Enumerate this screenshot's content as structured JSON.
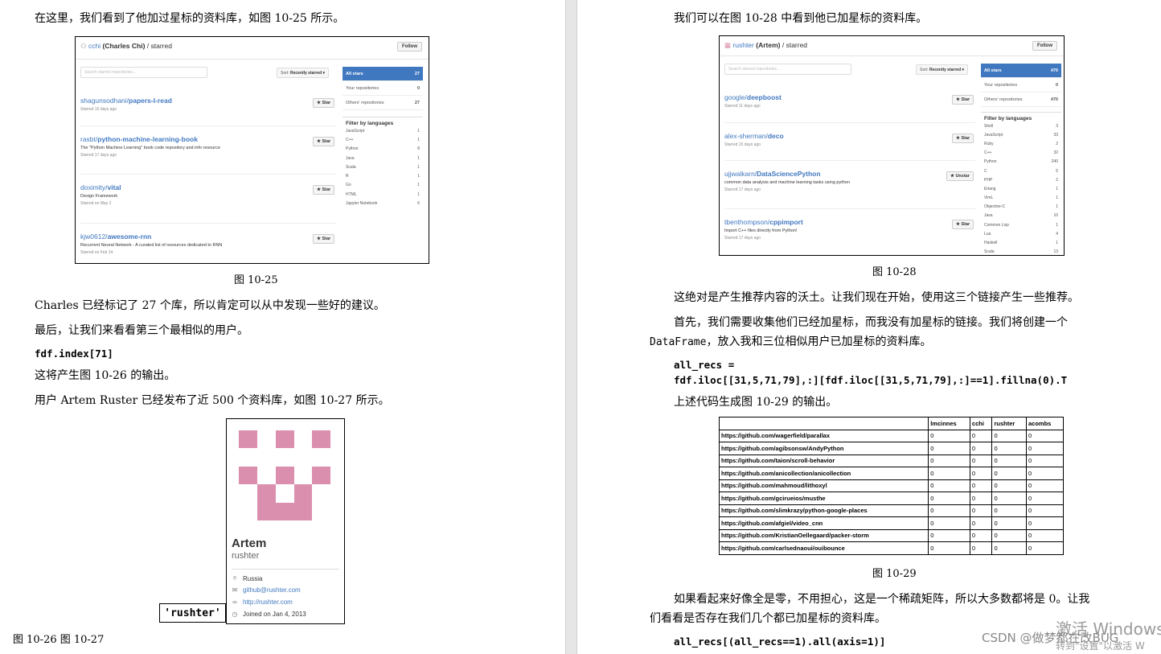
{
  "left": {
    "intro": "在这里，我们看到了他加过星标的资料库，如图 10-25 所示。",
    "fig25": {
      "user": "cchi",
      "fullname": "(Charles Chi)",
      "section": "/ starred",
      "follow": "Follow",
      "search_placeholder": "Search starred repositories...",
      "sort_prefix": "Sort:",
      "sort_value": "Recently starred ▾",
      "repos": [
        {
          "owner": "shagunsodhani/",
          "name": "papers-I-read",
          "desc": "",
          "date": "Starred 16 days ago",
          "btn": "★ Star"
        },
        {
          "owner": "rasbt/",
          "name": "python-machine-learning-book",
          "desc": "The \"Python Machine Learning\" book code repository and info resource",
          "date": "Starred 17 days ago",
          "btn": "★ Star"
        },
        {
          "owner": "doximity/",
          "name": "vital",
          "desc": "Design Framework",
          "date": "Starred on May 2",
          "btn": "★ Star"
        },
        {
          "owner": "kjw0612/",
          "name": "awesome-rnn",
          "desc": "Recurrent Neural Network - A curated list of resources dedicated to RNN",
          "date": "Starred on Feb 14",
          "btn": "★ Star"
        }
      ],
      "tabs": [
        {
          "label": "All stars",
          "count": "27"
        },
        {
          "label": "Your repositories",
          "count": "0"
        },
        {
          "label": "Others' repositories",
          "count": "27"
        }
      ],
      "filter_title": "Filter by languages",
      "languages": [
        {
          "name": "JavaScript",
          "count": "1"
        },
        {
          "name": "C++",
          "count": "1"
        },
        {
          "name": "Python",
          "count": "8"
        },
        {
          "name": "Java",
          "count": "1"
        },
        {
          "name": "Scala",
          "count": "1"
        },
        {
          "name": "R",
          "count": "1"
        },
        {
          "name": "Go",
          "count": "1"
        },
        {
          "name": "HTML",
          "count": "1"
        },
        {
          "name": "Jupyter Notebook",
          "count": "6"
        }
      ]
    },
    "caption25": "图 10-25",
    "p1": "Charles 已经标记了 27 个库，所以肯定可以从中发现一些好的建议。",
    "p2": "最后，让我们来看看第三个最相似的用户。",
    "code1": "fdf.index[71]",
    "p3": "这将产生图 10-26 的输出。",
    "p4": "用户 Artem Ruster 已经发布了近 500 个资料库，如图 10-27 所示。",
    "profile": {
      "name": "Artem",
      "login": "rushter",
      "location": "Russia",
      "email": "github@rushter.com",
      "url": "http://rushter.com",
      "joined": "Joined on Jan 4, 2013"
    },
    "rushter_label": "'rushter'",
    "caption2627": "图 10-26 图 10-27"
  },
  "right": {
    "intro": "我们可以在图 10-28 中看到他已加星标的资料库。",
    "fig28": {
      "user": "rushter",
      "fullname": "(Artem)",
      "section": "/ starred",
      "follow": "Follow",
      "search_placeholder": "Search starred repositories...",
      "sort_prefix": "Sort:",
      "sort_value": "Recently starred ▾",
      "repos": [
        {
          "owner": "google/",
          "name": "deepboost",
          "desc": "",
          "date": "Starred 11 days ago",
          "btn": "★ Star"
        },
        {
          "owner": "alex-sherman/",
          "name": "deco",
          "desc": "",
          "date": "Starred 15 days ago",
          "btn": "★ Star"
        },
        {
          "owner": "ujjwalkarn/",
          "name": "DataSciencePython",
          "desc": "common data analysis and machine learning tasks using python",
          "date": "Starred 17 days ago",
          "btn": "★ Unstar"
        },
        {
          "owner": "tbenthompson/",
          "name": "cppimport",
          "desc": "Import C++ files directly from Python!",
          "date": "Starred 17 days ago",
          "btn": "★ Star"
        }
      ],
      "tabs": [
        {
          "label": "All stars",
          "count": "470"
        },
        {
          "label": "Your repositories",
          "count": "0"
        },
        {
          "label": "Others' repositories",
          "count": "470"
        }
      ],
      "filter_title": "Filter by languages",
      "languages": [
        {
          "name": "Shell",
          "count": "3"
        },
        {
          "name": "JavaScript",
          "count": "33"
        },
        {
          "name": "Ruby",
          "count": "2"
        },
        {
          "name": "C++",
          "count": "32"
        },
        {
          "name": "Python",
          "count": "240"
        },
        {
          "name": "C",
          "count": "5"
        },
        {
          "name": "PHP",
          "count": "2"
        },
        {
          "name": "Erlang",
          "count": "1"
        },
        {
          "name": "VimL",
          "count": "1"
        },
        {
          "name": "Objective-C",
          "count": "1"
        },
        {
          "name": "Java",
          "count": "10"
        },
        {
          "name": "Common Lisp",
          "count": "1"
        },
        {
          "name": "Lua",
          "count": "4"
        },
        {
          "name": "Haskell",
          "count": "1"
        },
        {
          "name": "Scala",
          "count": "13"
        }
      ]
    },
    "caption28": "图 10-28",
    "p1": "这绝对是产生推荐内容的沃土。让我们现在开始，使用这三个链接产生一些推荐。",
    "p2a": "首先，我们需要收集他们已经加星标，而我没有加星标的链接。我们将创建一个",
    "p2b_code": "DataFrame",
    "p2b_text": "，放入我和三位相似用户已加星标的资料库。",
    "code2": "all_recs =",
    "code3": "fdf.iloc[[31,5,71,79],:][fdf.iloc[[31,5,71,79],:]==1].fillna(0).T",
    "p3": "上述代码生成图 10-29 的输出。",
    "table": {
      "columns": [
        "",
        "lmcinnes",
        "cchi",
        "rushter",
        "acombs"
      ],
      "rows": [
        [
          "https://github.com/wagerfield/parallax",
          "0",
          "0",
          "0",
          "0"
        ],
        [
          "https://github.com/agibsonsw/AndyPython",
          "0",
          "0",
          "0",
          "0"
        ],
        [
          "https://github.com/taion/scroll-behavior",
          "0",
          "0",
          "0",
          "0"
        ],
        [
          "https://github.com/anicollection/anicollection",
          "0",
          "0",
          "0",
          "0"
        ],
        [
          "https://github.com/mahmoud/lithoxyl",
          "0",
          "0",
          "0",
          "0"
        ],
        [
          "https://github.com/gcirueios/musthe",
          "0",
          "0",
          "0",
          "0"
        ],
        [
          "https://github.com/slimkrazy/python-google-places",
          "0",
          "0",
          "0",
          "0"
        ],
        [
          "https://github.com/afgiel/video_cnn",
          "0",
          "0",
          "0",
          "0"
        ],
        [
          "https://github.com/KristianOellegaard/packer-storm",
          "0",
          "0",
          "0",
          "0"
        ],
        [
          "https://github.com/carlsednaoui/ouibounce",
          "0",
          "0",
          "0",
          "0"
        ]
      ]
    },
    "caption29": "图 10-29",
    "p4a": "如果看起来好像全是零，不用担心，这是一个稀疏矩阵，所以大多数都将是  0。让我",
    "p4b": "们看看是否存在我们几个都已加星标的资料库。",
    "code4": "all_recs[(all_recs==1).all(axis=1)]"
  },
  "overlay": {
    "watermark_line1": "激活 Windows",
    "watermark_line2": "转到\"设置\"以激活 W",
    "csdn": "CSDN @做梦都在改BUG"
  }
}
